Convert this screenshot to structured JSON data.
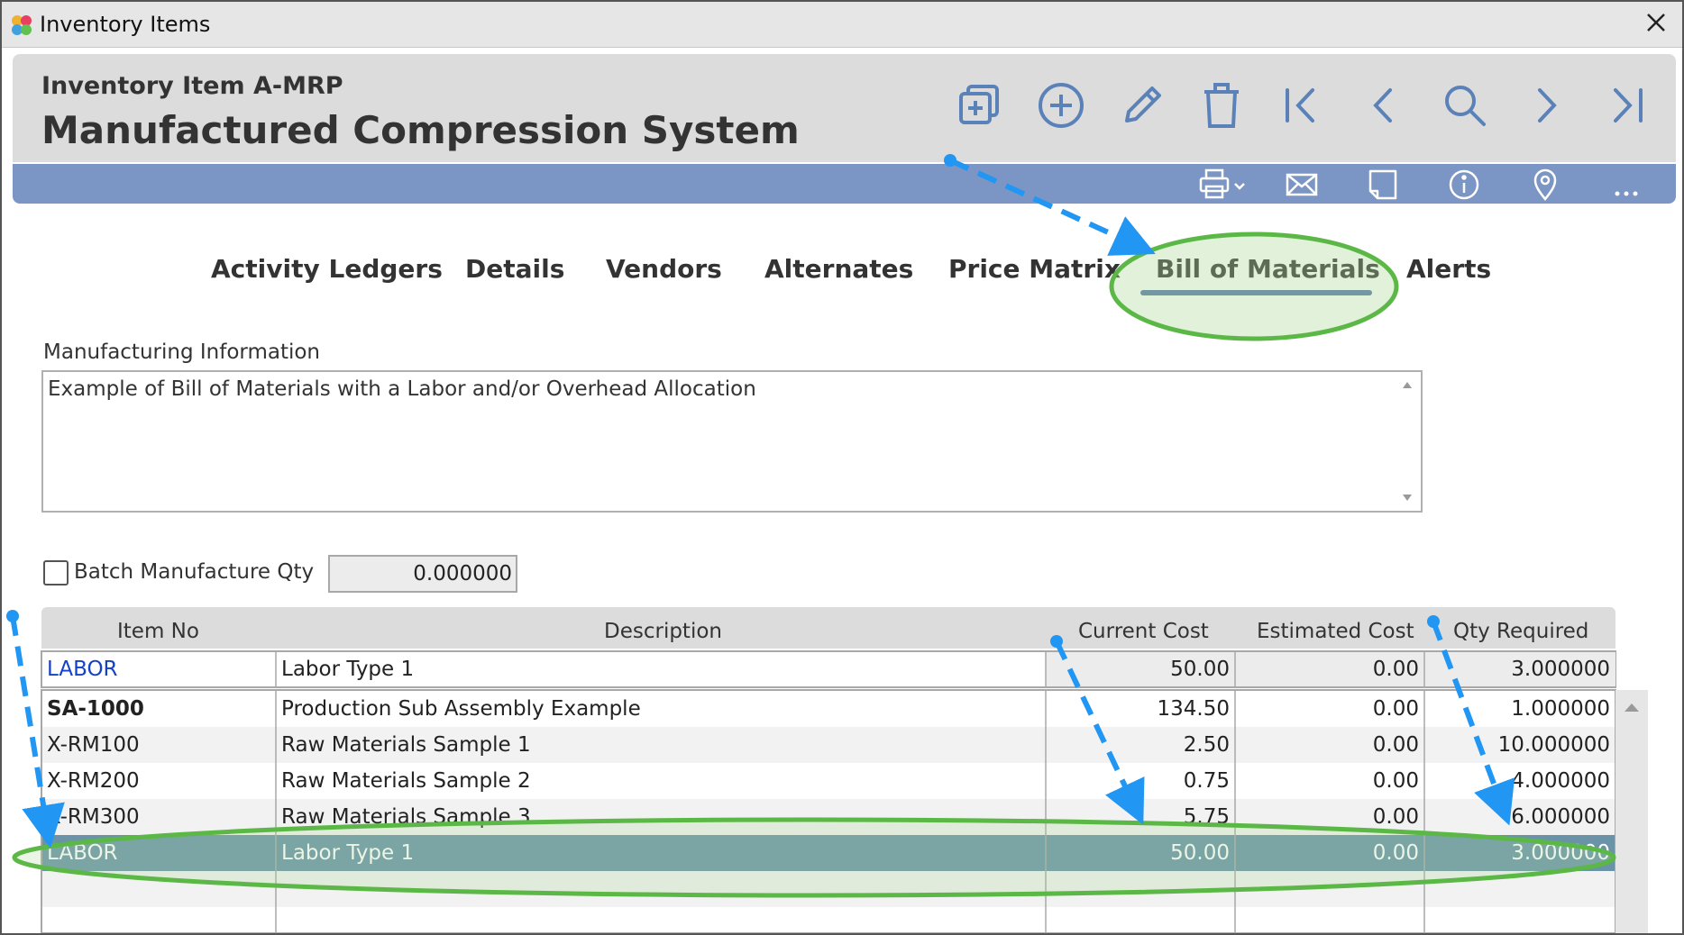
{
  "window": {
    "title": "Inventory Items"
  },
  "header": {
    "item_label": "Inventory Item A-MRP",
    "item_name": "Manufactured Compression System"
  },
  "toolbar": [
    "duplicate-icon",
    "add-icon",
    "edit-icon",
    "delete-icon",
    "first-record-icon",
    "previous-record-icon",
    "search-icon",
    "next-record-icon",
    "last-record-icon"
  ],
  "toolbar2": [
    "print-icon",
    "email-icon",
    "note-icon",
    "info-icon",
    "location-icon",
    "more-icon"
  ],
  "tabs": [
    {
      "label": "Activity Ledgers"
    },
    {
      "label": "Details"
    },
    {
      "label": "Vendors"
    },
    {
      "label": "Alternates"
    },
    {
      "label": "Price Matrix"
    },
    {
      "label": "Bill of Materials",
      "active": true
    },
    {
      "label": "Alerts"
    }
  ],
  "manufacturing": {
    "label": "Manufacturing Information",
    "text": "Example of Bill of Materials with a Labor and/or Overhead Allocation"
  },
  "batch": {
    "label": "Batch Manufacture Qty",
    "value": "0.000000",
    "checked": false
  },
  "grid": {
    "columns": [
      "Item No",
      "Description",
      "Current Cost",
      "Estimated Cost",
      "Qty Required"
    ],
    "entry": {
      "item": "LABOR",
      "desc": "Labor Type 1",
      "cost": "50.00",
      "est": "0.00",
      "qty": "3.000000"
    },
    "rows": [
      {
        "item": "SA-1000",
        "desc": "Production Sub Assembly Example",
        "cost": "134.50",
        "est": "0.00",
        "qty": "1.000000"
      },
      {
        "item": "X-RM100",
        "desc": "Raw Materials Sample 1",
        "cost": "2.50",
        "est": "0.00",
        "qty": "10.000000"
      },
      {
        "item": "X-RM200",
        "desc": "Raw Materials Sample 2",
        "cost": "0.75",
        "est": "0.00",
        "qty": "4.000000"
      },
      {
        "item": "X-RM300",
        "desc": "Raw Materials Sample 3",
        "cost": "5.75",
        "est": "0.00",
        "qty": "6.000000"
      },
      {
        "item": "LABOR",
        "desc": "Labor Type 1",
        "cost": "50.00",
        "est": "0.00",
        "qty": "3.000000",
        "selected": true
      }
    ]
  },
  "colors": {
    "accent_bar": "#7b96c4",
    "selected_row": "#6b93a8",
    "annotation_arrow": "#2196f3",
    "highlight_ellipse": "#5cb846"
  }
}
